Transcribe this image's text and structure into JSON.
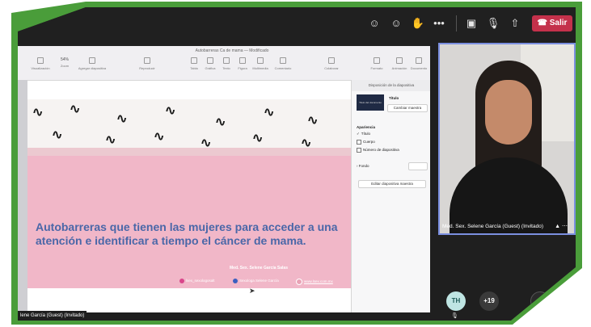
{
  "meeting": {
    "leave_label": "Salir",
    "icons": [
      "people-icon",
      "reactions-icon",
      "raise-hand-icon",
      "more-options-icon",
      "camera-off-icon",
      "mic-off-icon",
      "share-icon",
      "phone-icon"
    ],
    "more_glyph": "•••"
  },
  "shared_app": {
    "doc_title": "Autobarreras Ca de mama — Modificado",
    "zoom_value": "54%",
    "toolbar": [
      "Visualización",
      "Zoom",
      "Agregar diapositiva",
      "Reproducir",
      "Tabla",
      "Gráfica",
      "Texto",
      "Figura",
      "Multimedia",
      "Comentario",
      "Colaborar",
      "Formato",
      "Animación",
      "Documento"
    ]
  },
  "slide": {
    "title": "Autobarreras que tienen las mujeres para acceder a una atención e  identificar a tiempo el cáncer de mama.",
    "author": "Med. Sex. Selene García Salas",
    "social": [
      {
        "icon": "instagram-icon",
        "text": "lsex_sexologosalt",
        "color": "#d9468b"
      },
      {
        "icon": "facebook-icon",
        "text": "Sexologa Selene García",
        "color": "#3b5fbf"
      },
      {
        "icon": "web-icon",
        "text": "www.lsex.com.mx",
        "color": "#ffffff"
      }
    ]
  },
  "format_panel": {
    "header": "Disposición de la diapositiva",
    "thumb_text": "Titulo del documento",
    "layout_name": "Título",
    "change_master": "Cambiar maestra",
    "appearance_label": "Apariencia",
    "options": [
      {
        "label": "Título",
        "checked": true
      },
      {
        "label": "Cuerpo",
        "checked": false
      },
      {
        "label": "Número de diapositiva",
        "checked": false
      }
    ],
    "background_label": "Fondo",
    "edit_master": "Editar diapositiva maestra"
  },
  "speaker": {
    "name": "Med. Sex. Selene García (Guest) (Invitado)"
  },
  "participants": {
    "initials": "TH",
    "more_count": "+19"
  },
  "bottom_name": "lene García (Guest) (Invitado)"
}
